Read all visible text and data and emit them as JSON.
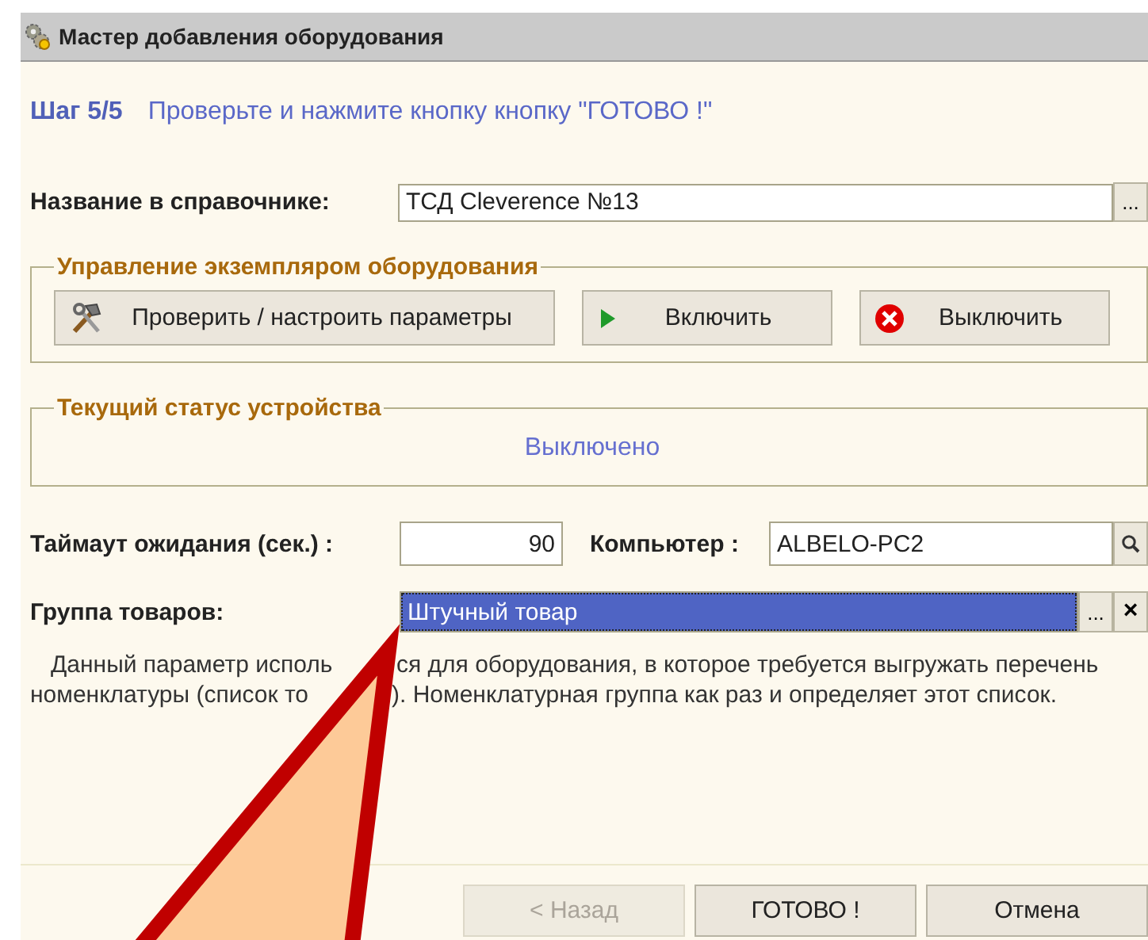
{
  "window": {
    "title": "Мастер добавления оборудования"
  },
  "step": {
    "label": "Шаг 5/5",
    "instruction": "Проверьте и нажмите кнопку кнопку \"ГОТОВО !\""
  },
  "name_field": {
    "label": "Название в справочнике:",
    "value": "ТСД Cleverence №13",
    "button": "..."
  },
  "control_group": {
    "title": "Управление экземпляром оборудования",
    "buttons": [
      {
        "kind": "tools",
        "label": "Проверить / настроить параметры"
      },
      {
        "kind": "play",
        "label": "Включить"
      },
      {
        "kind": "stop",
        "label": "Выключить"
      }
    ]
  },
  "status_group": {
    "title": "Текущий статус устройства",
    "value": "Выключено"
  },
  "timeout": {
    "label": "Таймаут ожидания (сек.) :",
    "value": "90"
  },
  "computer": {
    "label": "Компьютер :",
    "value": "ALBELO-PC2"
  },
  "goods_group": {
    "label": "Группа товаров:",
    "value": "Штучный товар",
    "selected": true,
    "button": "...",
    "clear": "×"
  },
  "description": [
    {
      "parts": [
        "Данный параметр исполь",
        "ся для оборудования, в которое требуется выгружать перечень"
      ]
    },
    {
      "parts": [
        "номенклатуры (список то",
        "). Номенклатурная группа как раз и определяет этот список."
      ]
    }
  ],
  "footer_buttons": [
    {
      "label": "< Назад",
      "disabled": true
    },
    {
      "label": "ГОТОВО !",
      "disabled": false
    },
    {
      "label": "Отмена",
      "disabled": false
    }
  ],
  "annotation": {
    "kind": "arrow"
  }
}
